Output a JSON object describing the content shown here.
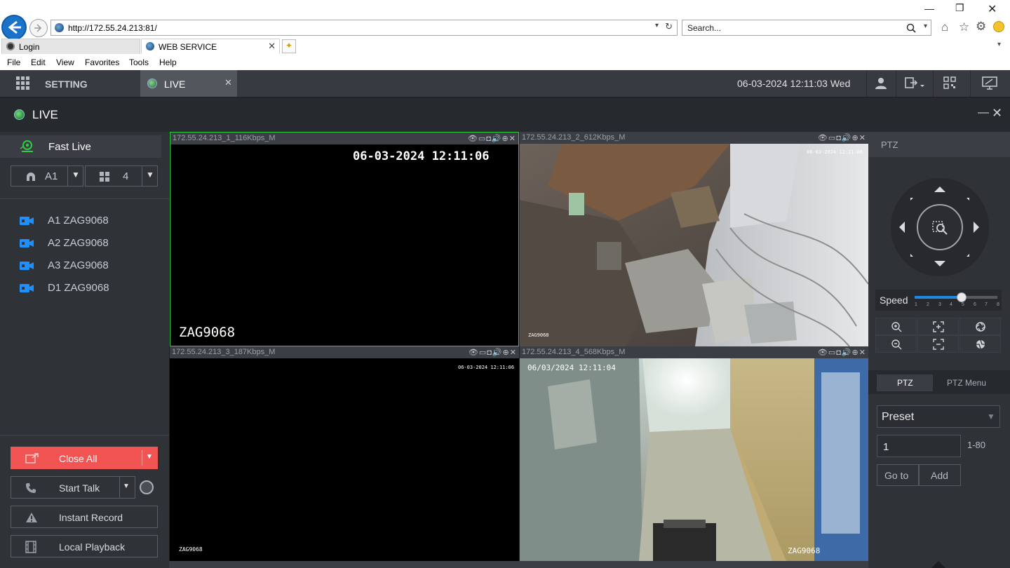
{
  "browser": {
    "url": "http://172.55.24.213:81/",
    "search_placeholder": "Search...",
    "tabs": [
      {
        "label": "Login"
      },
      {
        "label": "WEB SERVICE"
      }
    ],
    "menu": [
      "File",
      "Edit",
      "View",
      "Favorites",
      "Tools",
      "Help"
    ]
  },
  "topbar": {
    "setting_label": "SETTING",
    "live_tab_label": "LIVE",
    "datetime": "06-03-2024 12:11:03 Wed"
  },
  "titlebar": {
    "title": "LIVE"
  },
  "left_panel": {
    "fast_live_label": "Fast Live",
    "group_select": "A1",
    "layout_select": "4",
    "devices": [
      {
        "label": "A1 ZAG9068"
      },
      {
        "label": "A2 ZAG9068"
      },
      {
        "label": "A3 ZAG9068"
      },
      {
        "label": "D1 ZAG9068"
      }
    ],
    "buttons": {
      "close_all": "Close All",
      "start_talk": "Start Talk",
      "instant_record": "Instant Record",
      "local_playback": "Local Playback"
    }
  },
  "videos": [
    {
      "header": "172.55.24.213_1_116Kbps_M",
      "osd_time": "06-03-2024 12:11:06",
      "osd_name": "ZAG9068"
    },
    {
      "header": "172.55.24.213_2_612Kbps_M",
      "osd_time": "06-03-2024 12:11:06",
      "osd_name": "ZAG9068"
    },
    {
      "header": "172.55.24.213_3_187Kbps_M",
      "osd_time": "06-03-2024 12:11:06",
      "osd_name": "ZAG9068"
    },
    {
      "header": "172.55.24.213_4_568Kbps_M",
      "osd_time": "06/03/2024 12:11:04",
      "osd_name": "ZAG9068"
    }
  ],
  "right_panel": {
    "ptz_header": "PTZ",
    "speed_label": "Speed",
    "speed_ticks": [
      "1",
      "2",
      "3",
      "4",
      "5",
      "6",
      "7",
      "8"
    ],
    "speed_value": 5,
    "tab_ptz": "PTZ",
    "tab_ptz_menu": "PTZ Menu",
    "preset_select": "Preset",
    "preset_value": "1",
    "preset_range": "1-80",
    "goto_label": "Go to",
    "add_label": "Add"
  },
  "colors": {
    "accent_red": "#f25353",
    "active_green": "#2ecc40",
    "camera_blue": "#1e90ff",
    "slider_blue": "#1e88e5"
  }
}
